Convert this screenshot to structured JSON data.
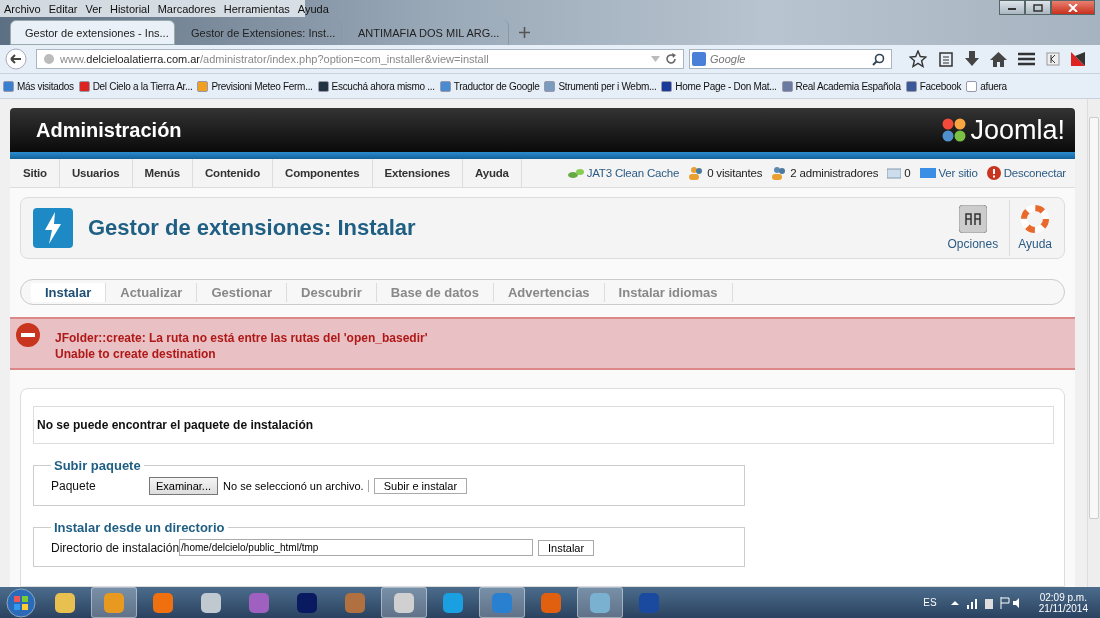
{
  "browser": {
    "menu": [
      "Archivo",
      "Editar",
      "Ver",
      "Historial",
      "Marcadores",
      "Herramientas",
      "Ayuda"
    ],
    "tabs": [
      {
        "title": "Gestor de extensiones - Ins...",
        "selected": true
      },
      {
        "title": "Gestor de Extensiones: Inst...",
        "selected": false
      },
      {
        "title": "ANTIMAFIA DOS MIL ARG...",
        "selected": false
      }
    ],
    "url": "www.**delcieloalatierra.com.ar**/administrator/index.php?option=com_installer&view=install",
    "search": {
      "placeholder": "Google"
    },
    "bookmarks": [
      "Más visitados",
      "Del Cielo a la Tierra Ar...",
      "Previsioni Meteo Ferm...",
      "Escuchá ahora mismo ...",
      "Traductor de Google",
      "Strumenti per i Webm...",
      "Home Page - Don Mat...",
      "Real Academia Española",
      "Facebook",
      "afuera"
    ]
  },
  "admin": {
    "title": "Administración",
    "logo": "Joomla!",
    "nav": [
      "Sitio",
      "Usuarios",
      "Menús",
      "Contenido",
      "Componentes",
      "Extensiones",
      "Ayuda"
    ],
    "status": [
      {
        "kind": "cache",
        "text": "JAT3 Clean Cache"
      },
      {
        "kind": "visitors",
        "text": "0 visitantes"
      },
      {
        "kind": "admins",
        "text": "2 administradores"
      },
      {
        "kind": "messages",
        "text": "0"
      },
      {
        "kind": "site",
        "text": "Ver sitio"
      },
      {
        "kind": "logout",
        "text": "Desconectar"
      }
    ],
    "page_title": "Gestor de extensiones: Instalar",
    "toolbar": [
      {
        "kind": "options",
        "label": "Opciones"
      },
      {
        "kind": "help",
        "label": "Ayuda"
      }
    ],
    "subtabs": [
      {
        "label": "Instalar",
        "selected": true
      },
      {
        "label": "Actualizar",
        "selected": false
      },
      {
        "label": "Gestionar",
        "selected": false
      },
      {
        "label": "Descubrir",
        "selected": false
      },
      {
        "label": "Base de datos",
        "selected": false
      },
      {
        "label": "Advertencias",
        "selected": false
      },
      {
        "label": "Instalar idiomas",
        "selected": false
      }
    ],
    "error": [
      "JFolder::create: La ruta no está entre las rutas del 'open_basedir'",
      "Unable to create destination"
    ],
    "message": "No se puede encontrar el paquete de instalación",
    "upload": {
      "legend": "Subir paquete",
      "label": "Paquete",
      "browse": "Examinar...",
      "file_status": "No se seleccionó un archivo.",
      "button": "Subir e instalar"
    },
    "directory": {
      "legend": "Instalar desde un directorio",
      "label": "Directorio de instalación",
      "value": "/home/delcielo/public_html/tmp",
      "button": "Instalar"
    }
  },
  "taskbar": {
    "language": "ES",
    "time": "02:09 p.m.",
    "date": "21/11/2014"
  }
}
